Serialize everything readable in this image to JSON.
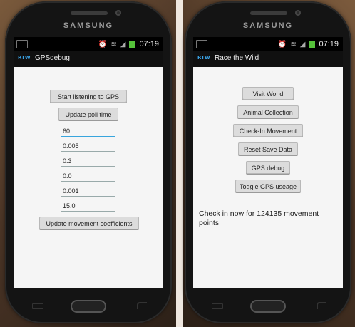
{
  "left_phone": {
    "brand": "SAMSUNG",
    "status_time": "07:19",
    "app_icon_text": "RTW",
    "title": "GPSdebug",
    "buttons": {
      "start_listening": "Start listening to GPS",
      "update_poll_time": "Update poll time",
      "update_coefficients": "Update movement coefficients"
    },
    "fields": [
      "60",
      "0.005",
      "0.3",
      "0.0",
      "0.001",
      "15.0"
    ]
  },
  "right_phone": {
    "brand": "SAMSUNG",
    "status_time": "07:19",
    "app_icon_text": "RTW",
    "title": "Race the Wild",
    "buttons": {
      "visit_world": "Visit World",
      "animal_collection": "Animal Collection",
      "check_in_movement": "Check-In Movement",
      "reset_save_data": "Reset Save Data",
      "gps_debug": "GPS debug",
      "toggle_gps": "Toggle GPS useage"
    },
    "message": "Check in now for 124135 movement points"
  },
  "colors": {
    "battery": "#55c23a",
    "app_icon": "#39a3e6",
    "focus_underline": "#38a5dd"
  },
  "icons": [
    "sd-card-icon",
    "alarm-icon",
    "wifi-icon",
    "signal-icon",
    "battery-icon"
  ]
}
